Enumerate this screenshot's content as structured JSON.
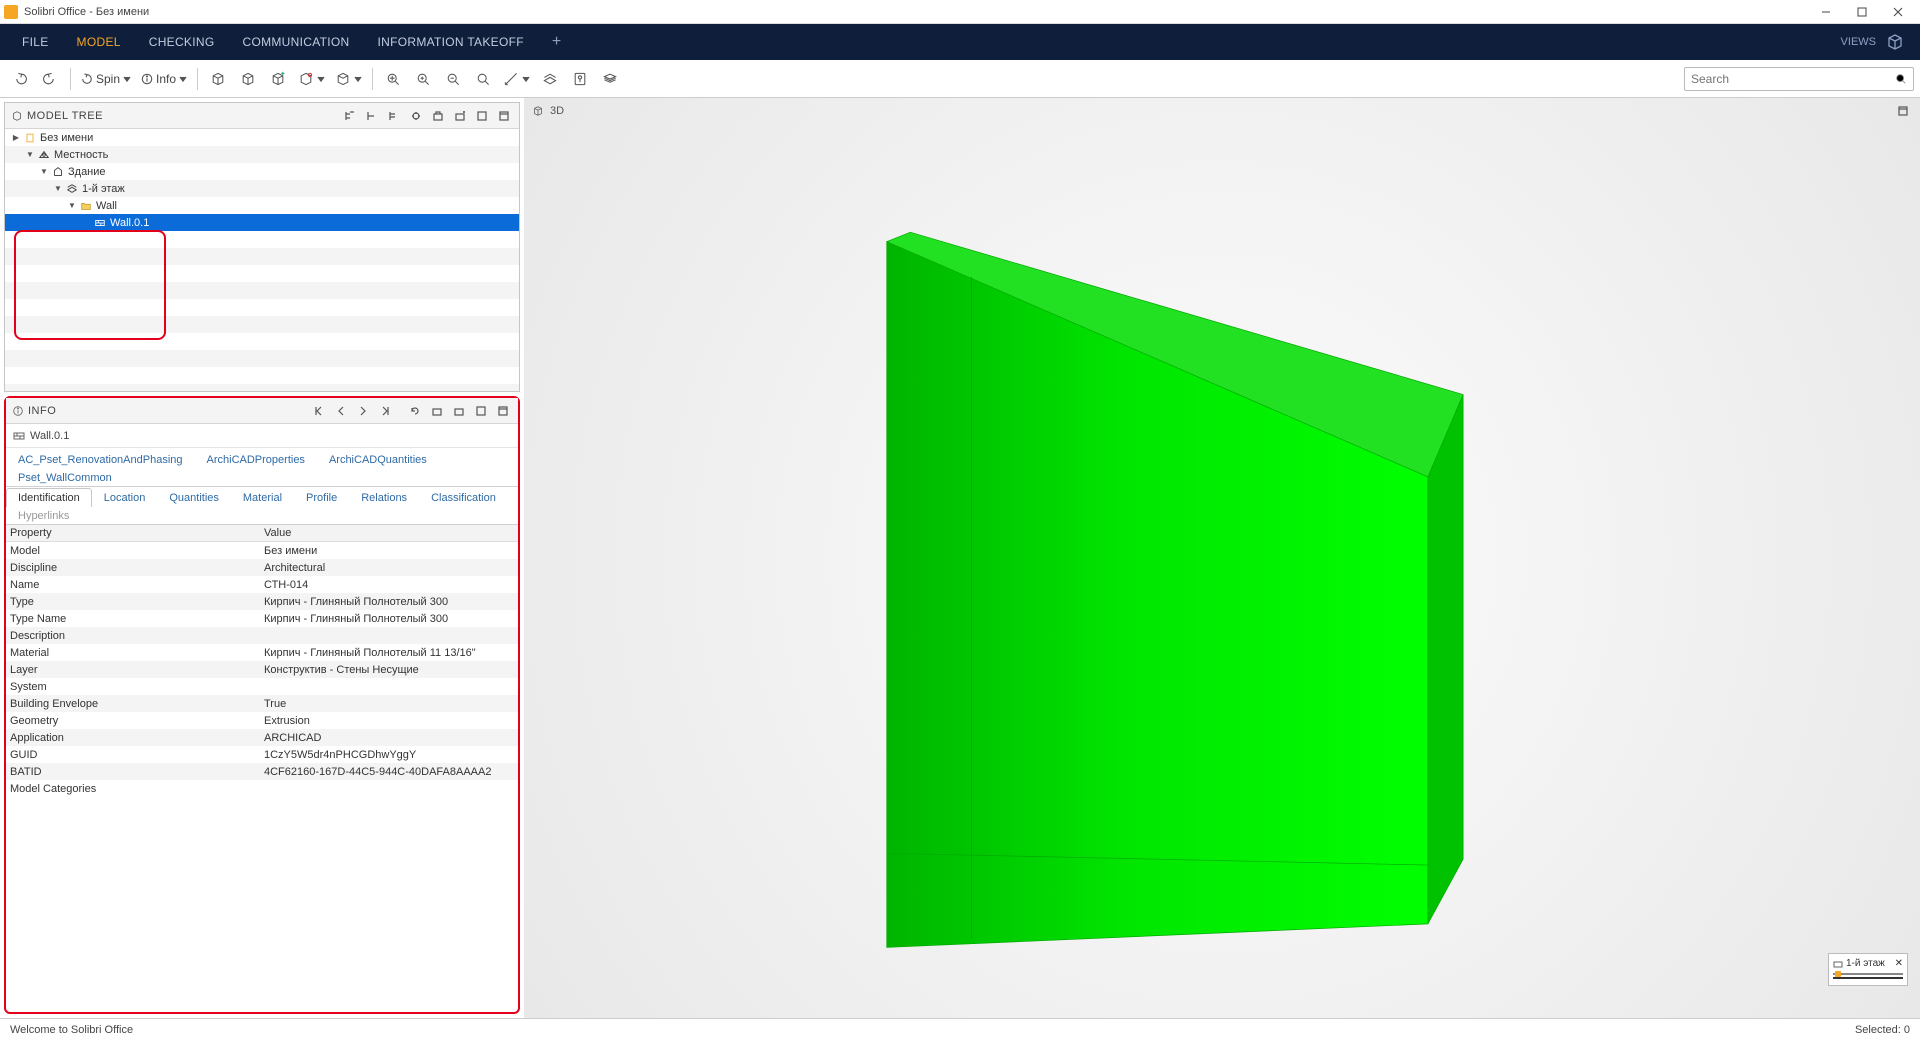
{
  "window": {
    "title": "Solibri Office - Без имени"
  },
  "menu": {
    "items": [
      "FILE",
      "MODEL",
      "CHECKING",
      "COMMUNICATION",
      "INFORMATION TAKEOFF"
    ],
    "active_index": 1,
    "views_label": "VIEWS"
  },
  "toolbar": {
    "spin_label": "Spin",
    "info_label": "Info",
    "search_placeholder": "Search"
  },
  "model_tree": {
    "title": "MODEL TREE",
    "items": [
      {
        "level": 0,
        "expanded": false,
        "icon": "file",
        "label": "Без имени"
      },
      {
        "level": 1,
        "expanded": true,
        "icon": "site",
        "label": "Местность"
      },
      {
        "level": 2,
        "expanded": true,
        "icon": "building",
        "label": "Здание"
      },
      {
        "level": 3,
        "expanded": true,
        "icon": "storey",
        "label": "1-й этаж"
      },
      {
        "level": 4,
        "expanded": true,
        "icon": "folder",
        "label": "Wall"
      },
      {
        "level": 5,
        "expanded": false,
        "icon": "wall",
        "label": "Wall.0.1",
        "selected": true,
        "leaf": true
      }
    ]
  },
  "info": {
    "title": "INFO",
    "object_name": "Wall.0.1",
    "tabs_top": [
      "AC_Pset_RenovationAndPhasing",
      "ArchiCADProperties",
      "ArchiCADQuantities",
      "Pset_WallCommon"
    ],
    "tabs_bottom": [
      "Identification",
      "Location",
      "Quantities",
      "Material",
      "Profile",
      "Relations",
      "Classification",
      "Hyperlinks"
    ],
    "active_tab": "Identification",
    "disabled_tab": "Hyperlinks",
    "columns": {
      "property": "Property",
      "value": "Value"
    },
    "rows": [
      {
        "k": "Model",
        "v": "Без имени"
      },
      {
        "k": "Discipline",
        "v": "Architectural"
      },
      {
        "k": "Name",
        "v": "СТН-014"
      },
      {
        "k": "Type",
        "v": "Кирпич - Глиняный Полнотелый 300"
      },
      {
        "k": "Type Name",
        "v": "Кирпич - Глиняный Полнотелый 300"
      },
      {
        "k": "Description",
        "v": ""
      },
      {
        "k": "Material",
        "v": "Кирпич - Глиняный Полнотелый 11 13/16\""
      },
      {
        "k": "Layer",
        "v": "Конструктив - Стены Несущие"
      },
      {
        "k": "System",
        "v": ""
      },
      {
        "k": "Building Envelope",
        "v": "True"
      },
      {
        "k": "Geometry",
        "v": "Extrusion"
      },
      {
        "k": "Application",
        "v": "ARCHICAD"
      },
      {
        "k": "GUID",
        "v": "1CzY5W5dr4nPHCGDhwYggY"
      },
      {
        "k": "BATID",
        "v": "4CF62160-167D-44C5-944C-40DAFA8AAAA2"
      },
      {
        "k": "Model Categories",
        "v": ""
      }
    ]
  },
  "view3d": {
    "title": "3D"
  },
  "floor_widget": {
    "label": "1-й этаж"
  },
  "status": {
    "left": "Welcome to Solibri Office",
    "right": "Selected: 0"
  }
}
